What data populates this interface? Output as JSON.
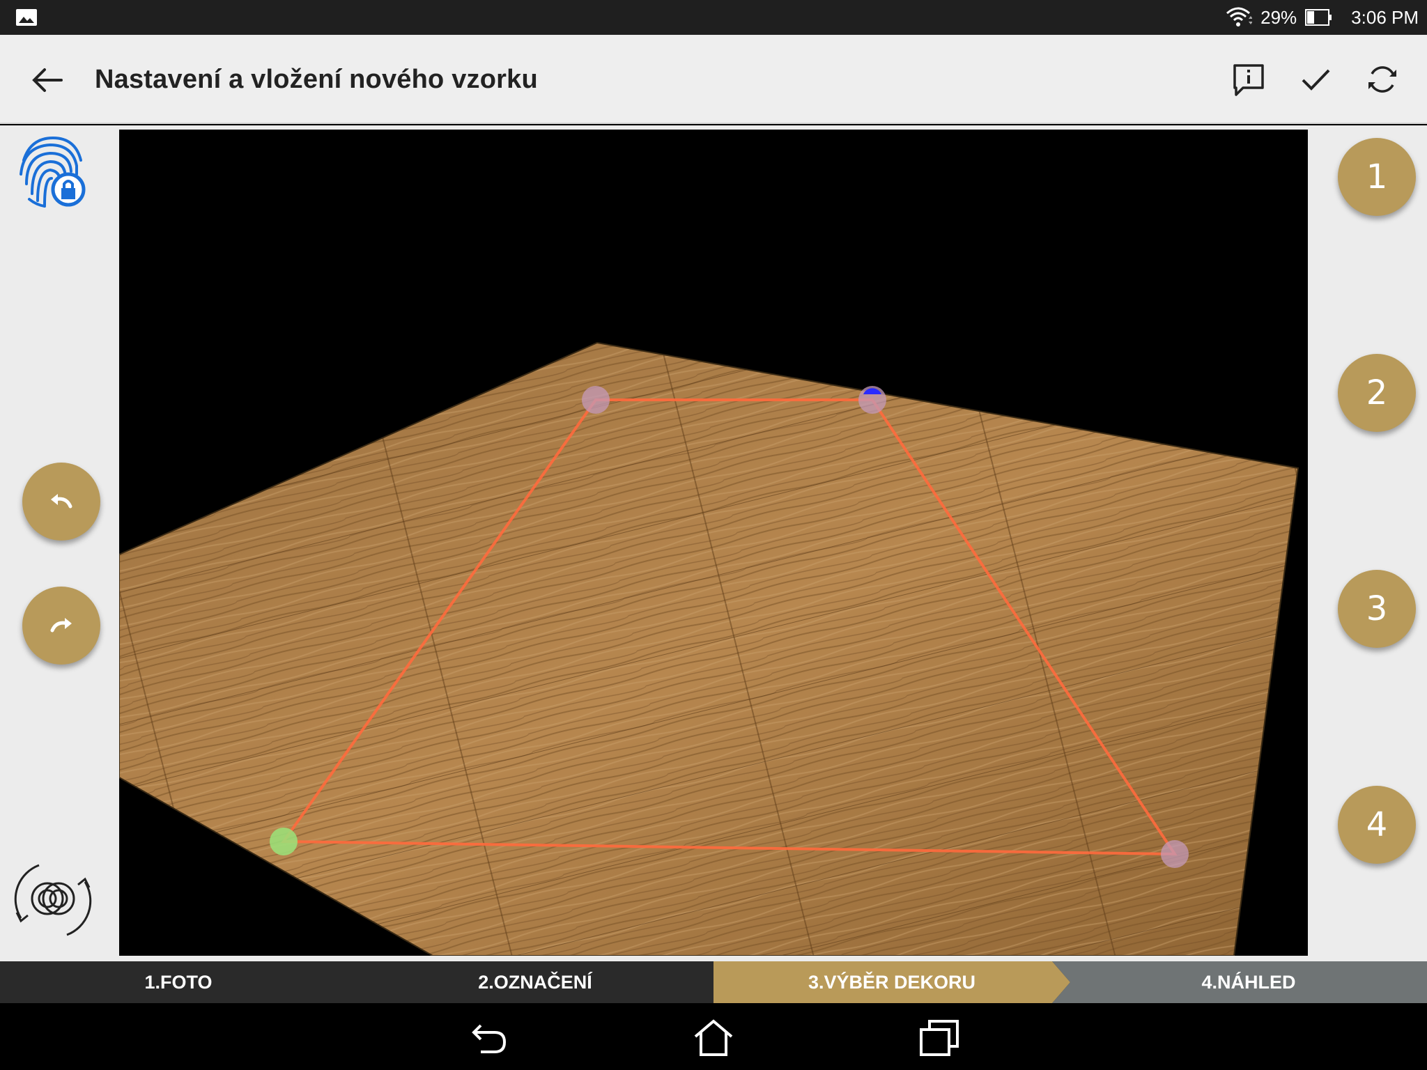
{
  "status_bar": {
    "battery_percent": "29%",
    "time": "3:06 PM",
    "icons": [
      "gallery-icon",
      "wifi-icon",
      "battery-icon"
    ]
  },
  "app_bar": {
    "title": "Nastavení a vložení nového vzorku",
    "actions": [
      "info-icon",
      "check-icon",
      "refresh-icon"
    ]
  },
  "left_tools": {
    "icons": [
      "fingerprint-lock-icon",
      "undo-icon",
      "redo-icon",
      "rotate-rings-icon"
    ]
  },
  "corner_buttons": [
    "1",
    "2",
    "3",
    "4"
  ],
  "steps": [
    {
      "label": "1.FOTO"
    },
    {
      "label": "2.OZNAČENÍ"
    },
    {
      "label": "3.VÝBĚR DEKORU"
    },
    {
      "label": "4.NÁHLED"
    }
  ],
  "active_step": 3,
  "colors": {
    "accent_gold": "#b99a59",
    "step_inactive": "#6f7475",
    "selection_line": "#ff6a3d",
    "handle_start": "#9be37a",
    "handle_default": "#c49ab8"
  },
  "navbar": {
    "icons": [
      "back-nav-icon",
      "home-nav-icon",
      "recents-nav-icon"
    ]
  }
}
